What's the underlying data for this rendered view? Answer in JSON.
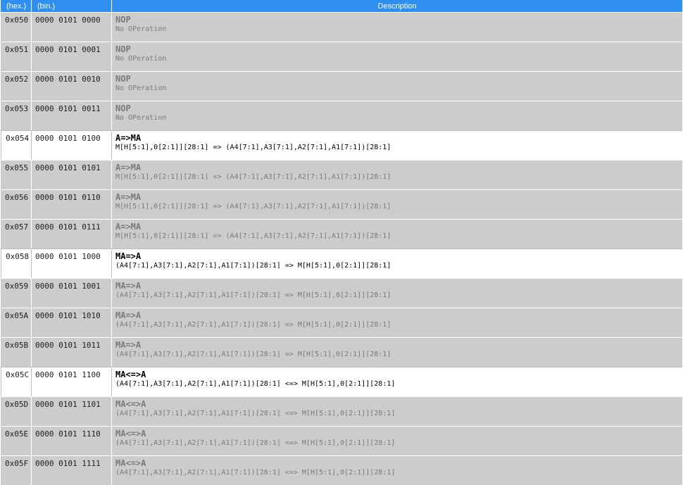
{
  "headers": {
    "hex": "(hex.)",
    "bin": "(bin.)",
    "desc": "Description"
  },
  "rows": [
    {
      "hex": "0x050",
      "bin": "0000 0101 0000",
      "mnemonic": "NOP",
      "expr": "No OPeration",
      "highlighted": false
    },
    {
      "hex": "0x051",
      "bin": "0000 0101 0001",
      "mnemonic": "NOP",
      "expr": "No OPeration",
      "highlighted": false
    },
    {
      "hex": "0x052",
      "bin": "0000 0101 0010",
      "mnemonic": "NOP",
      "expr": "No OPeration",
      "highlighted": false
    },
    {
      "hex": "0x053",
      "bin": "0000 0101 0011",
      "mnemonic": "NOP",
      "expr": "No OPeration",
      "highlighted": false
    },
    {
      "hex": "0x054",
      "bin": "0000 0101 0100",
      "mnemonic": "A=>MA",
      "expr": "M[H[5:1],0[2:1]][28:1] => (A4[7:1],A3[7:1],A2[7:1],A1[7:1])[28:1]",
      "highlighted": true
    },
    {
      "hex": "0x055",
      "bin": "0000 0101 0101",
      "mnemonic": "A=>MA",
      "expr": "M[H[5:1],0[2:1]][28:1] => (A4[7:1],A3[7:1],A2[7:1],A1[7:1])[28:1]",
      "highlighted": false
    },
    {
      "hex": "0x056",
      "bin": "0000 0101 0110",
      "mnemonic": "A=>MA",
      "expr": "M[H[5:1],0[2:1]][28:1] => (A4[7:1],A3[7:1],A2[7:1],A1[7:1])[28:1]",
      "highlighted": false
    },
    {
      "hex": "0x057",
      "bin": "0000 0101 0111",
      "mnemonic": "A=>MA",
      "expr": "M[H[5:1],0[2:1]][28:1] => (A4[7:1],A3[7:1],A2[7:1],A1[7:1])[28:1]",
      "highlighted": false
    },
    {
      "hex": "0x058",
      "bin": "0000 0101 1000",
      "mnemonic": "MA=>A",
      "expr": "(A4[7:1],A3[7:1],A2[7:1],A1[7:1])[28:1] => M[H[5:1],0[2:1]][28:1]",
      "highlighted": true
    },
    {
      "hex": "0x059",
      "bin": "0000 0101 1001",
      "mnemonic": "MA=>A",
      "expr": "(A4[7:1],A3[7:1],A2[7:1],A1[7:1])[28:1] => M[H[5:1],0[2:1]][28:1]",
      "highlighted": false
    },
    {
      "hex": "0x05A",
      "bin": "0000 0101 1010",
      "mnemonic": "MA=>A",
      "expr": "(A4[7:1],A3[7:1],A2[7:1],A1[7:1])[28:1] => M[H[5:1],0[2:1]][28:1]",
      "highlighted": false
    },
    {
      "hex": "0x05B",
      "bin": "0000 0101 1011",
      "mnemonic": "MA=>A",
      "expr": "(A4[7:1],A3[7:1],A2[7:1],A1[7:1])[28:1] => M[H[5:1],0[2:1]][28:1]",
      "highlighted": false
    },
    {
      "hex": "0x05C",
      "bin": "0000 0101 1100",
      "mnemonic": "MA<=>A",
      "expr": "(A4[7:1],A3[7:1],A2[7:1],A1[7:1])[28:1] <=> M[H[5:1],0[2:1]][28:1]",
      "highlighted": true
    },
    {
      "hex": "0x05D",
      "bin": "0000 0101 1101",
      "mnemonic": "MA<=>A",
      "expr": "(A4[7:1],A3[7:1],A2[7:1],A1[7:1])[28:1] <=> M[H[5:1],0[2:1]][28:1]",
      "highlighted": false
    },
    {
      "hex": "0x05E",
      "bin": "0000 0101 1110",
      "mnemonic": "MA<=>A",
      "expr": "(A4[7:1],A3[7:1],A2[7:1],A1[7:1])[28:1] <=> M[H[5:1],0[2:1]][28:1]",
      "highlighted": false
    },
    {
      "hex": "0x05F",
      "bin": "0000 0101 1111",
      "mnemonic": "MA<=>A",
      "expr": "(A4[7:1],A3[7:1],A2[7:1],A1[7:1])[28:1] <=> M[H[5:1],0[2:1]][28:1]",
      "highlighted": false
    }
  ]
}
